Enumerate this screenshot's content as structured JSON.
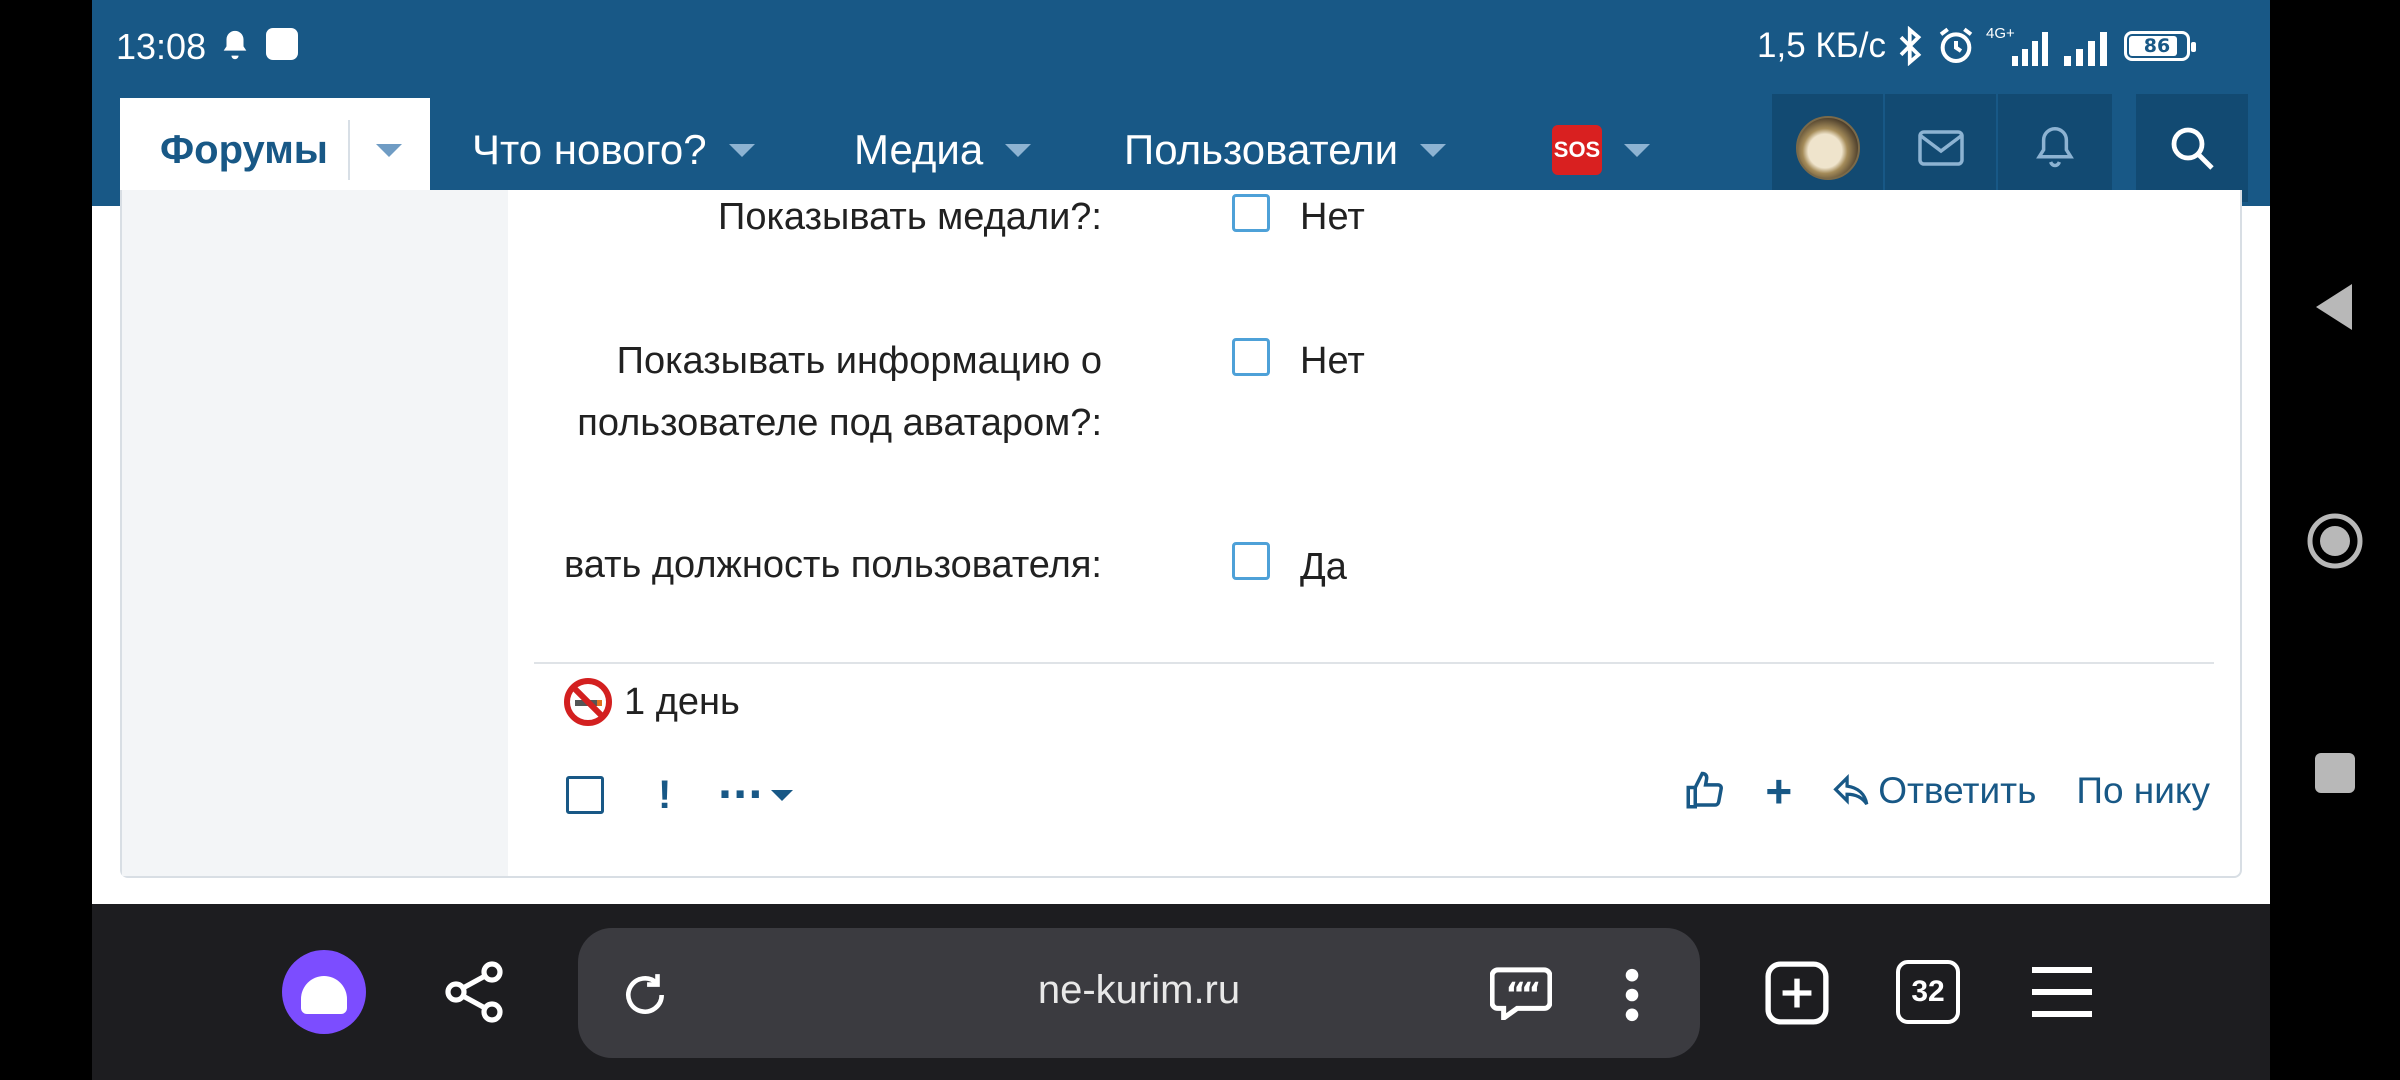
{
  "status_bar": {
    "time": "13:08",
    "network_speed": "1,5 КБ/с",
    "network_type": "4G+",
    "battery_level": "86",
    "battery_percent": 86,
    "icons": [
      "bell-icon",
      "app-notification-icon",
      "bluetooth-icon",
      "alarm-icon",
      "signal-4g-icon",
      "signal-icon",
      "battery-icon"
    ]
  },
  "nav": {
    "forums": "Форумы",
    "whats_new": "Что нового?",
    "media": "Медиа",
    "users": "Пользователи",
    "sos": "SOS"
  },
  "settings": [
    {
      "label": "Показывать медали?:",
      "value": "Нет",
      "checked": false
    },
    {
      "label_line1": "Показывать информацию о",
      "label_line2": "пользователе под аватаром?:",
      "value": "Нет",
      "checked": false
    },
    {
      "label": "вать должность пользователя:",
      "value": "Да",
      "checked": false
    }
  ],
  "ban": {
    "text": "1 день"
  },
  "post_actions": {
    "more": "···",
    "reply": "Ответить",
    "by_nick": "По нику",
    "plus": "+"
  },
  "browser": {
    "url": "ne-kurim.ru",
    "tab_count": "32"
  },
  "colors": {
    "brand": "#185886",
    "checkbox": "#4ea1d8",
    "alice": "#7c4dff"
  }
}
